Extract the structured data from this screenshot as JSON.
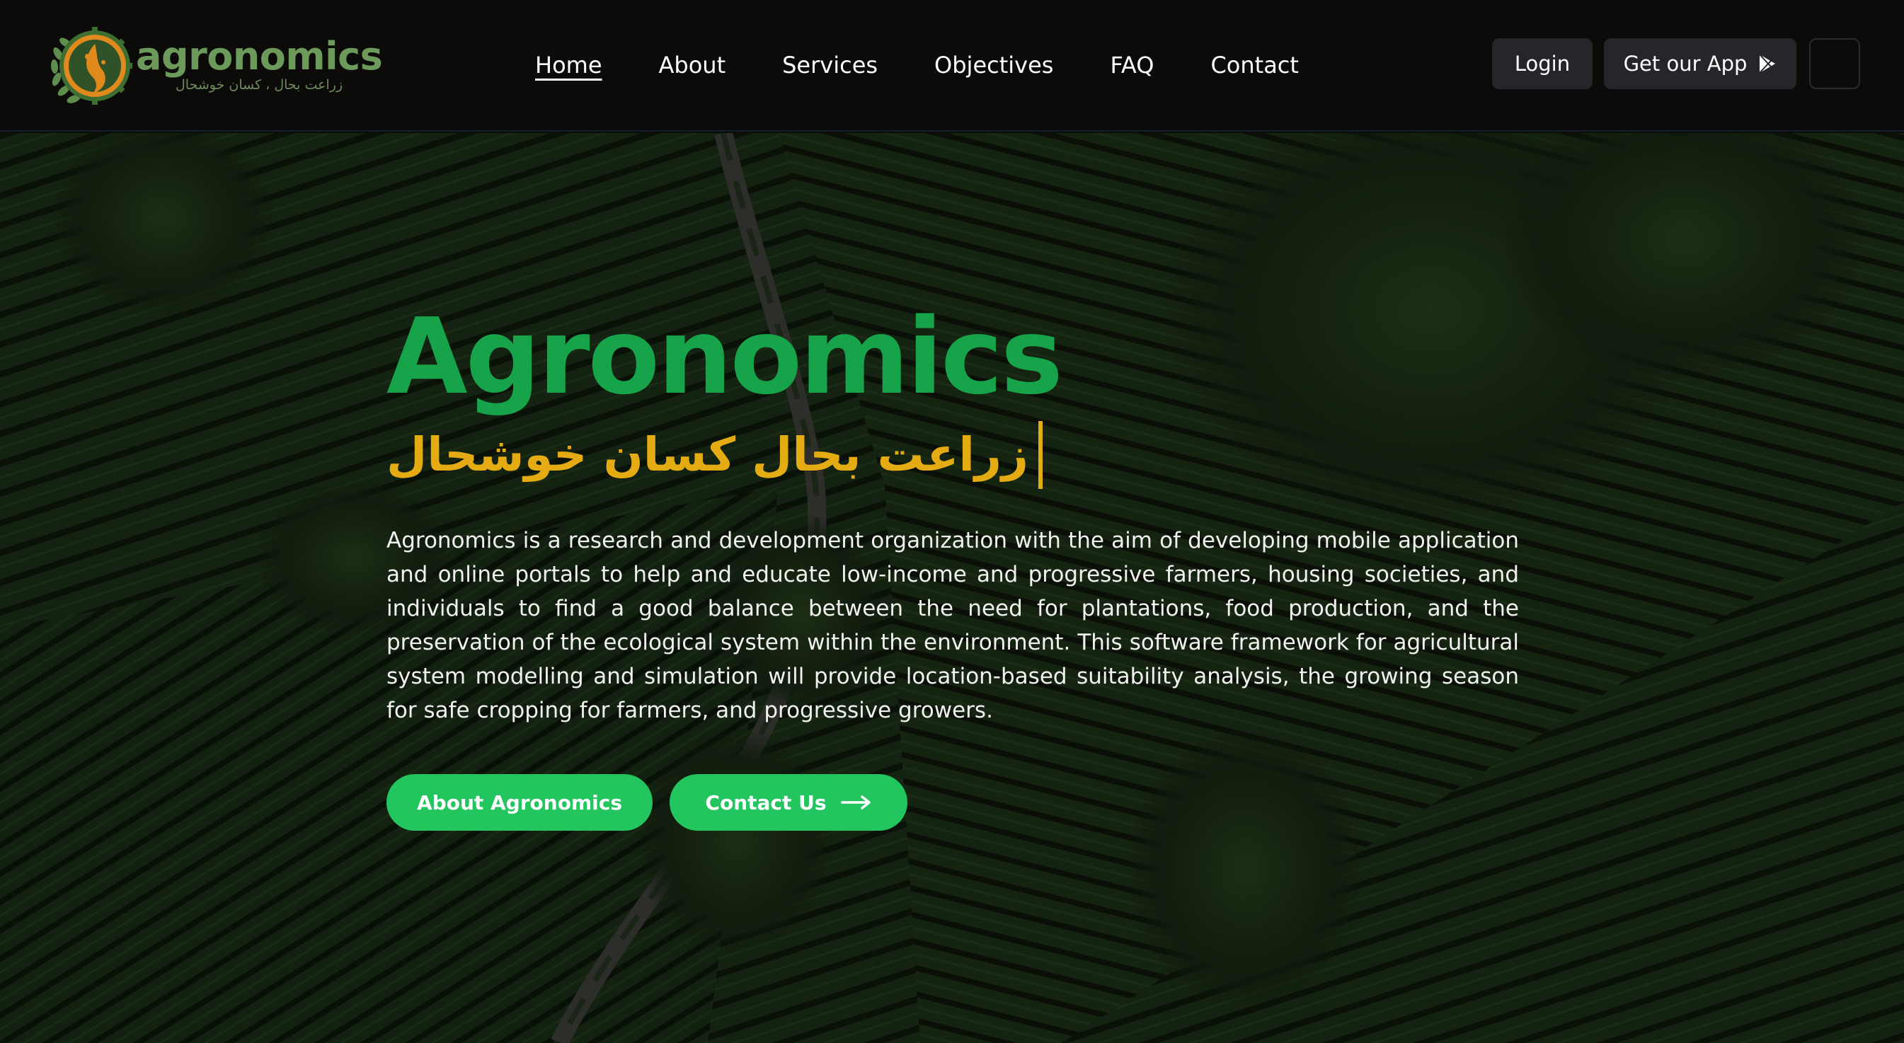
{
  "brand": {
    "name": "agronomics",
    "tagline": "زراعت بحال ، کسان خوشحال"
  },
  "nav": {
    "links": [
      {
        "label": "Home",
        "active": true
      },
      {
        "label": "About",
        "active": false
      },
      {
        "label": "Services",
        "active": false
      },
      {
        "label": "Objectives",
        "active": false
      },
      {
        "label": "FAQ",
        "active": false
      },
      {
        "label": "Contact",
        "active": false
      }
    ],
    "login_label": "Login",
    "app_label": "Get our App",
    "app_icon": "play-store-icon",
    "menu_icon": "menu-icon"
  },
  "hero": {
    "title": "Agronomics",
    "subtitle": "زراعت بحال کسان خوشحال",
    "description": "Agronomics is a research and development organization with the aim of developing mobile application and online portals to help and educate low-income and progressive farmers, housing societies, and individuals to find a good balance between the need for plantations, food production, and the preservation of the ecological system within the environment. This software framework for agricultural system modelling and simulation will provide location-based suitability analysis, the growing season for safe cropping for farmers, and progressive growers.",
    "primary_button": "About Agronomics",
    "secondary_button": "Contact Us",
    "secondary_icon": "arrow-right-icon"
  },
  "colors": {
    "title_green": "#16a34a",
    "button_green": "#22c55e",
    "subtitle_gold": "#e4ab12",
    "brand_green": "#6c9a5a",
    "logo_orange": "#e08a1e",
    "nav_bg": "#0c0b0a",
    "dark_button": "#25252a"
  }
}
